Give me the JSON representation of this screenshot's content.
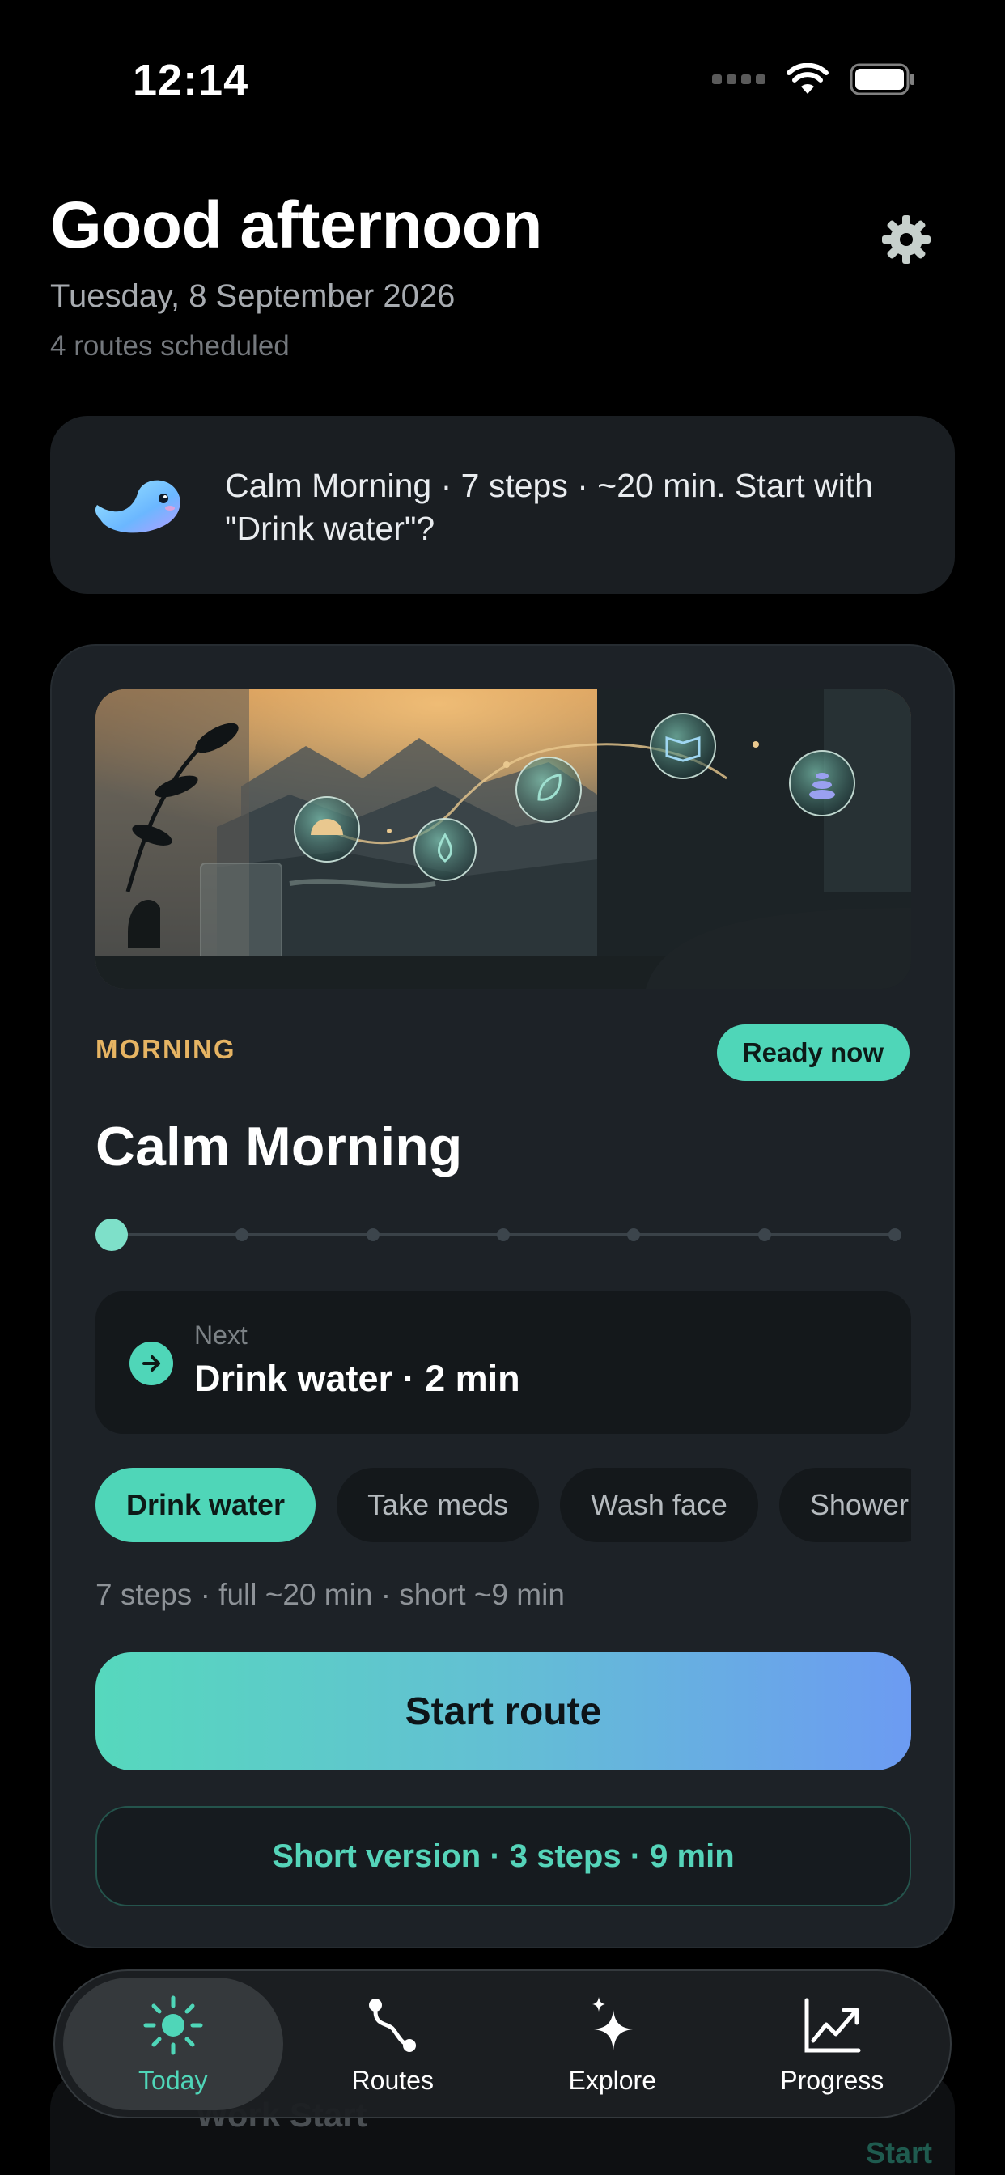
{
  "status_bar": {
    "time": "12:14"
  },
  "header": {
    "greeting": "Good afternoon",
    "date": "Tuesday, 8 September 2026",
    "routes_count": "4 routes scheduled"
  },
  "suggestion": {
    "text": "Calm Morning · 7 steps · ~20 min. Start with \"Drink water\"?"
  },
  "route_card": {
    "time_of_day": "MORNING",
    "badge": "Ready now",
    "title": "Calm Morning",
    "progress": {
      "total_steps": 7,
      "current_step": 1
    },
    "next": {
      "label": "Next",
      "value": "Drink water · 2 min"
    },
    "chips": [
      "Drink water",
      "Take meds",
      "Wash face",
      "Shower"
    ],
    "meta": "7 steps · full ~20 min · short ~9 min",
    "start_label": "Start route",
    "short_label": "Short version · 3 steps · 9 min"
  },
  "peek_card": {
    "title": "Work Start",
    "right": "Start"
  },
  "tab_bar": {
    "tabs": [
      {
        "label": "Today",
        "icon": "sun-icon",
        "active": true
      },
      {
        "label": "Routes",
        "icon": "route-icon",
        "active": false
      },
      {
        "label": "Explore",
        "icon": "sparkle-icon",
        "active": false
      },
      {
        "label": "Progress",
        "icon": "chart-icon",
        "active": false
      }
    ]
  },
  "colors": {
    "accent": "#4fd6b8",
    "time_label": "#e6b463",
    "card": "#1d2227",
    "background": "#000000"
  }
}
